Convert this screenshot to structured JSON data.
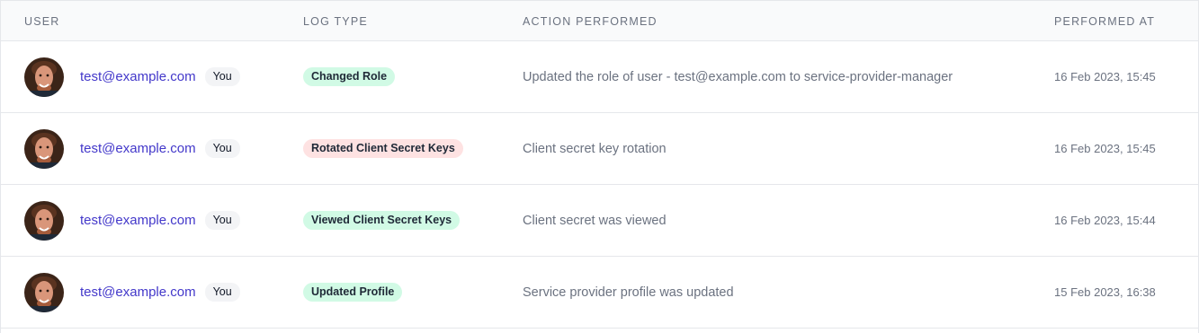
{
  "columns": {
    "user": "User",
    "log_type": "Log Type",
    "action": "Action Performed",
    "performed_at": "Performed At"
  },
  "you_label": "You",
  "rows": [
    {
      "email": "test@example.com",
      "log_type": "Changed Role",
      "badge_color": "#d1fae5",
      "action": "Updated the role of user - test@example.com to service-provider-manager",
      "performed_at": "16 Feb 2023, 15:45"
    },
    {
      "email": "test@example.com",
      "log_type": "Rotated Client Secret Keys",
      "badge_color": "#fee2e2",
      "action": "Client secret key rotation",
      "performed_at": "16 Feb 2023, 15:45"
    },
    {
      "email": "test@example.com",
      "log_type": "Viewed Client Secret Keys",
      "badge_color": "#d1fae5",
      "action": "Client secret was viewed",
      "performed_at": "16 Feb 2023, 15:44"
    },
    {
      "email": "test@example.com",
      "log_type": "Updated Profile",
      "badge_color": "#d1fae5",
      "action": "Service provider profile was updated",
      "performed_at": "15 Feb 2023, 16:38"
    }
  ]
}
